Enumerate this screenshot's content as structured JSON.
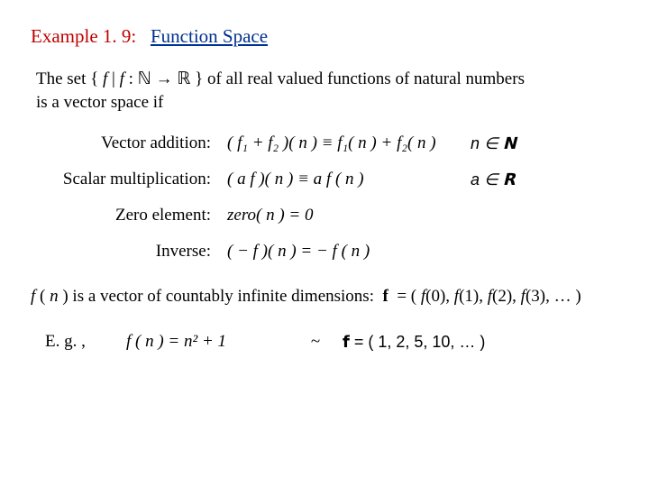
{
  "title": {
    "ex": "Example 1. 9:",
    "name": "Function Space"
  },
  "intro": {
    "line1_pre": "The set  { ",
    "line1_f": "f ",
    "line1_mid": "|  ",
    "line1_f2": "f ",
    "line1_map": ": ℕ → ℝ }  of all real valued functions of natural numbers",
    "line2": "is a vector space if"
  },
  "rows": {
    "add": {
      "label": "Vector addition:",
      "def": "( f₁ + f₂ )( n ) ≡ f₁( n ) + f₂( n )",
      "cond": "n ∈ 𝗡"
    },
    "scal": {
      "label": "Scalar multiplication:",
      "def": "( a f )( n ) ≡ a f ( n )",
      "cond": "a ∈ 𝗥"
    },
    "zero": {
      "label": "Zero element:",
      "def": "zero( n ) = 0",
      "cond": ""
    },
    "inv": {
      "label": "Inverse:",
      "def": "( − f )( n ) = − f ( n )",
      "cond": ""
    }
  },
  "vec": {
    "pre": "f ( n ) is a vector of countably infinite dimensions:  ",
    "expr": "f  = ( f(0), f(1), f(2), f(3), … )"
  },
  "eg": {
    "label": "E. g. ,",
    "def": "f ( n ) = n² + 1",
    "tilde": "~",
    "vec": "𝗳 = ( 1, 2, 5, 10, … )"
  }
}
